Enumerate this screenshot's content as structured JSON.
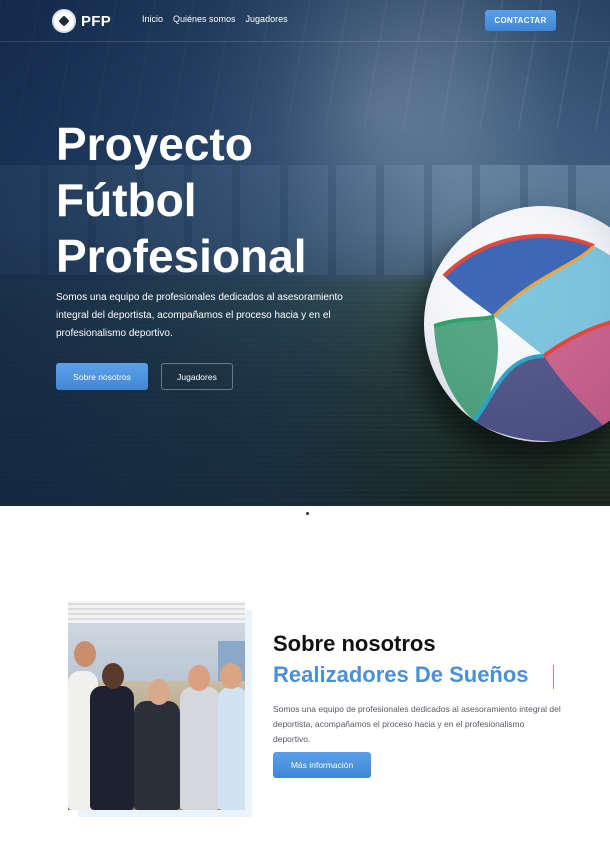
{
  "brand": {
    "name": "PFP",
    "logo_icon": "soccer-ball-icon"
  },
  "nav": {
    "links": [
      "Inicio",
      "Quiénes somos",
      "Jugadores"
    ],
    "contact_label": "CONTACTAR"
  },
  "hero": {
    "title_lines": [
      "Proyecto",
      "Fútbol",
      "Profesional"
    ],
    "description": "Somos una equipo de profesionales dedicados al asesoramiento integral del deportista, acompañamos el proceso hacia y en el profesionalismo deportivo.",
    "primary_button": "Sobre nosotros",
    "secondary_button": "Jugadores"
  },
  "about": {
    "title": "Sobre nosotros",
    "subtitle": "Realizadores De Sueños",
    "description": "Somos una equipo de profesionales dedicados al asesoramiento integral del deportista, acompañamos el proceso hacia y en el profesionalismo deportivo.",
    "button": "Más información"
  },
  "colors": {
    "accent": "#4a90d9",
    "button_blue": "#4386d3",
    "hero_overlay": "#1a3354",
    "heading_dark": "#111111",
    "body_text": "#555a62"
  }
}
